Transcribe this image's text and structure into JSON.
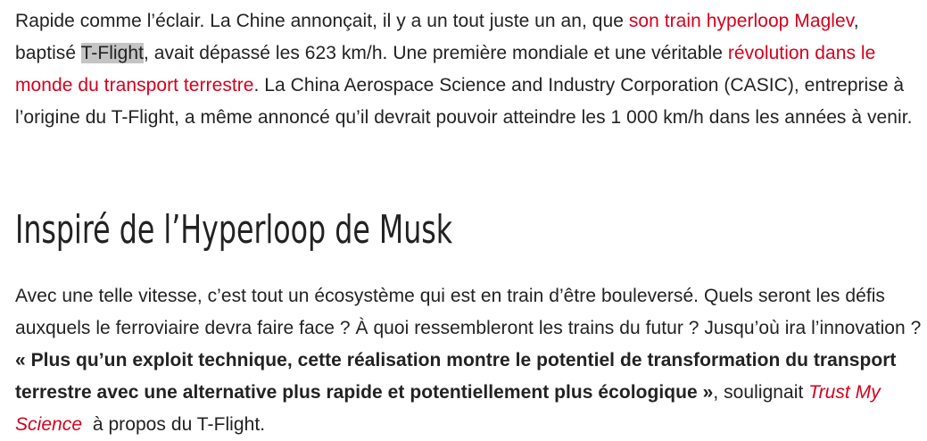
{
  "paragraph1": {
    "seg1": "Rapide comme l’éclair. La Chine annonçait, il y a un tout juste un an, que ",
    "link1": "son train hyperloop Maglev",
    "seg2": ", baptisé ",
    "highlight": "T-Flight",
    "seg3": ", avait dépassé les 623 km/h. Une première mondiale et une véritable ",
    "link2": "révolution dans le monde du transport terrestre",
    "seg4": ". La China Aerospace Science and Industry Corporation (CASIC), entreprise à l’origine du T-Flight, a même annoncé qu’il devrait pouvoir atteindre les 1 000 km/h dans les années à venir."
  },
  "heading": "Inspiré de l’Hyperloop de Musk",
  "paragraph2": {
    "seg1": "Avec une telle vitesse, c’est tout un écosystème qui est en train d’être bouleversé. Quels seront les défis auxquels le ferroviaire devra faire face ? À quoi ressembleront les trains du futur ? Jusqu’où ira l’innovation ? ",
    "quote": "« Plus qu’un exploit technique, cette réalisation montre le potentiel de transformation du transport terrestre avec une alternative plus rapide et potentiellement plus écologique »",
    "seg2": ", soulignait ",
    "link": "Trust My Science",
    "seg3": "  à propos du T-Flight."
  },
  "colors": {
    "text": "#222222",
    "link": "#d6001c",
    "highlight": "#c4c4c4"
  }
}
